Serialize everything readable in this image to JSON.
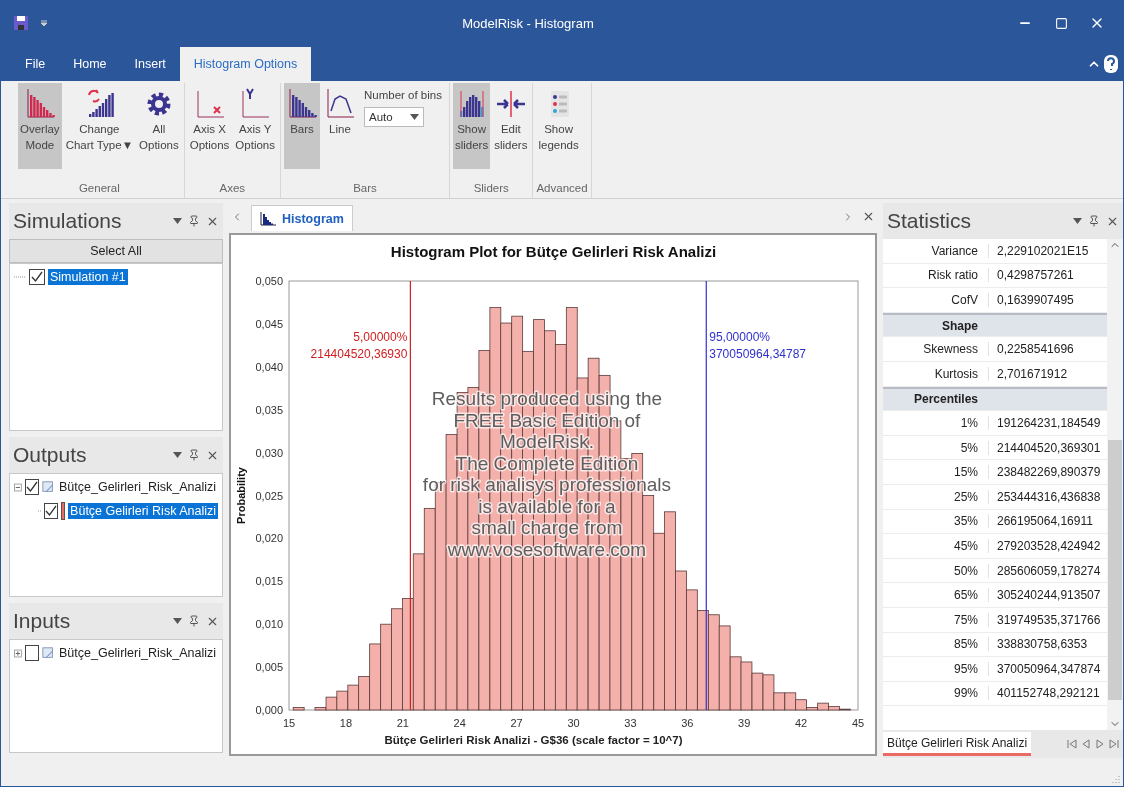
{
  "window": {
    "title": "ModelRisk - Histogram"
  },
  "ribbon_tabs": [
    {
      "label": "File",
      "selected": false
    },
    {
      "label": "Home",
      "selected": false
    },
    {
      "label": "Insert",
      "selected": false
    },
    {
      "label": "Histogram Options",
      "selected": true
    }
  ],
  "ribbon_groups": [
    {
      "label": "General",
      "items": [
        {
          "kind": "overlay",
          "lines": [
            "Overlay",
            "Mode"
          ],
          "selected": true
        },
        {
          "kind": "charttype",
          "lines": [
            "Change",
            "Chart Type▼"
          ],
          "selected": false
        },
        {
          "kind": "gear",
          "lines": [
            "All",
            "Options"
          ],
          "selected": false
        }
      ]
    },
    {
      "label": "Axes",
      "items": [
        {
          "kind": "axisx",
          "lines": [
            "Axis X",
            "Options"
          ],
          "selected": false
        },
        {
          "kind": "axisy",
          "lines": [
            "Axis Y",
            "Options"
          ],
          "selected": false
        }
      ]
    },
    {
      "label": "Bars",
      "items": [
        {
          "kind": "bars",
          "lines": [
            "Bars"
          ],
          "selected": true
        },
        {
          "kind": "line",
          "lines": [
            "Line"
          ],
          "selected": false
        },
        {
          "kind": "bins",
          "label": "Number of bins",
          "value": "Auto"
        }
      ]
    },
    {
      "label": "Sliders",
      "items": [
        {
          "kind": "sliders",
          "lines": [
            "Show",
            "sliders"
          ],
          "selected": true
        },
        {
          "kind": "editsliders",
          "lines": [
            "Edit",
            "sliders"
          ],
          "selected": false
        }
      ]
    },
    {
      "label": "Advanced",
      "items": [
        {
          "kind": "legends",
          "lines": [
            "Show",
            "legends"
          ],
          "selected": false
        }
      ]
    }
  ],
  "simulations": {
    "title": "Simulations",
    "select_all": "Select All",
    "items": [
      {
        "label": "Simulation #1",
        "checked": true,
        "selected": true
      }
    ]
  },
  "outputs": {
    "title": "Outputs",
    "items": [
      {
        "label": "Bütçe_Gelirleri_Risk_Analizi",
        "checked": true,
        "selected": false,
        "expanded": true,
        "children": [
          {
            "label": "Bütçe Gelirleri Risk Analizi",
            "checked": true,
            "selected": true,
            "color": "#ea6b63"
          }
        ]
      }
    ]
  },
  "inputs": {
    "title": "Inputs",
    "items": [
      {
        "label": "Bütçe_Gelirleri_Risk_Analizi",
        "checked": false,
        "selected": false,
        "expanded": false
      }
    ]
  },
  "document_tab": {
    "label": "Histogram"
  },
  "histogram": {
    "watermark": [
      "Results produced using the",
      "FREE Basic Edition of",
      "ModelRisk.",
      "The Complete Edition",
      "for risk analisys professionals",
      "is available for a",
      "small charge from",
      "www.vosesoftware.com"
    ],
    "chart_data": {
      "type": "bar",
      "title": "Histogram Plot for Bütçe Gelirleri Risk Analizi",
      "xlabel": "Bütçe Gelirleri Risk Analizi - G$36 (scale factor = 10^7)",
      "ylabel": "Probability",
      "x": [
        15.51,
        16.08,
        16.66,
        17.24,
        17.81,
        18.39,
        18.96,
        19.54,
        20.12,
        20.69,
        21.27,
        21.84,
        22.42,
        23.0,
        23.57,
        24.15,
        24.72,
        25.3,
        25.88,
        26.45,
        27.03,
        27.6,
        28.18,
        28.76,
        29.33,
        29.91,
        30.48,
        31.06,
        31.64,
        32.21,
        32.79,
        33.36,
        33.94,
        34.52,
        35.09,
        35.67,
        36.24,
        36.82,
        37.4,
        37.97,
        38.55,
        39.12,
        39.7,
        40.28,
        40.85,
        41.43,
        42.0,
        42.58,
        43.16,
        43.73,
        44.31
      ],
      "series": [
        {
          "color": "#f4b0aa",
          "values": [
            0.0003,
            0,
            0.0003,
            0.0015,
            0.0022,
            0.0029,
            0.0039,
            0.0077,
            0.01,
            0.0118,
            0.013,
            0.0182,
            0.0235,
            0.0265,
            0.0321,
            0.037,
            0.0376,
            0.0419,
            0.0469,
            0.0451,
            0.0459,
            0.0418,
            0.0455,
            0.0442,
            0.0426,
            0.0469,
            0.0387,
            0.041,
            0.039,
            0.0337,
            0.0293,
            0.0299,
            0.025,
            0.0206,
            0.0231,
            0.0162,
            0.014,
            0.0116,
            0.0111,
            0.0098,
            0.0062,
            0.0056,
            0.0043,
            0.0041,
            0.002,
            0.002,
            0.0012,
            0.0003,
            0.0008,
            0.0004,
            0.0001
          ]
        }
      ],
      "xlim": [
        15,
        45
      ],
      "ylim": [
        0,
        0.05
      ],
      "xticks": [
        15,
        18,
        21,
        24,
        27,
        30,
        33,
        36,
        39,
        42,
        45
      ],
      "yticks": [
        {
          "value": 0,
          "label": "0,000"
        },
        {
          "value": 0.005,
          "label": "0,005"
        },
        {
          "value": 0.01,
          "label": "0,010"
        },
        {
          "value": 0.015,
          "label": "0,015"
        },
        {
          "value": 0.02,
          "label": "0,020"
        },
        {
          "value": 0.025,
          "label": "0,025"
        },
        {
          "value": 0.03,
          "label": "0,030"
        },
        {
          "value": 0.035,
          "label": "0,035"
        },
        {
          "value": 0.04,
          "label": "0,040"
        },
        {
          "value": 0.045,
          "label": "0,045"
        },
        {
          "value": 0.05,
          "label": "0,050"
        }
      ],
      "ref_lines": [
        {
          "axis": "x",
          "value": 21.4,
          "color": "#d02020"
        },
        {
          "axis": "x",
          "value": 37.0,
          "color": "#3030d0"
        }
      ],
      "annotations": [
        "5,00000%",
        "214404520,36930",
        "95,00000%",
        "370050964,34787"
      ]
    }
  },
  "statistics": {
    "title": "Statistics",
    "rows": [
      {
        "kind": "row",
        "label": "Variance",
        "value": "2,229102021E15"
      },
      {
        "kind": "row",
        "label": "Risk ratio",
        "value": "0,4298757261"
      },
      {
        "kind": "row",
        "label": "CofV",
        "value": "0,1639907495"
      },
      {
        "kind": "section",
        "label": "Shape"
      },
      {
        "kind": "row",
        "label": "Skewness",
        "value": "0,2258541696"
      },
      {
        "kind": "row",
        "label": "Kurtosis",
        "value": "2,701671912"
      },
      {
        "kind": "section",
        "label": "Percentiles"
      },
      {
        "kind": "row",
        "label": "1%",
        "value": "191264231,184549"
      },
      {
        "kind": "row",
        "label": "5%",
        "value": "214404520,369301"
      },
      {
        "kind": "row",
        "label": "15%",
        "value": "238482269,890379"
      },
      {
        "kind": "row",
        "label": "25%",
        "value": "253444316,436838"
      },
      {
        "kind": "row",
        "label": "35%",
        "value": "266195064,16911"
      },
      {
        "kind": "row",
        "label": "45%",
        "value": "279203528,424942"
      },
      {
        "kind": "row",
        "label": "50%",
        "value": "285606059,178274"
      },
      {
        "kind": "row",
        "label": "65%",
        "value": "305240244,913507"
      },
      {
        "kind": "row",
        "label": "75%",
        "value": "319749535,371766"
      },
      {
        "kind": "row",
        "label": "85%",
        "value": "338830758,6353"
      },
      {
        "kind": "row",
        "label": "95%",
        "value": "370050964,347874"
      },
      {
        "kind": "row",
        "label": "99%",
        "value": "401152748,292121"
      }
    ],
    "sheet_tabs": [
      {
        "label": "Bütçe Gelirleri Risk Analizi",
        "selected": true
      }
    ]
  }
}
